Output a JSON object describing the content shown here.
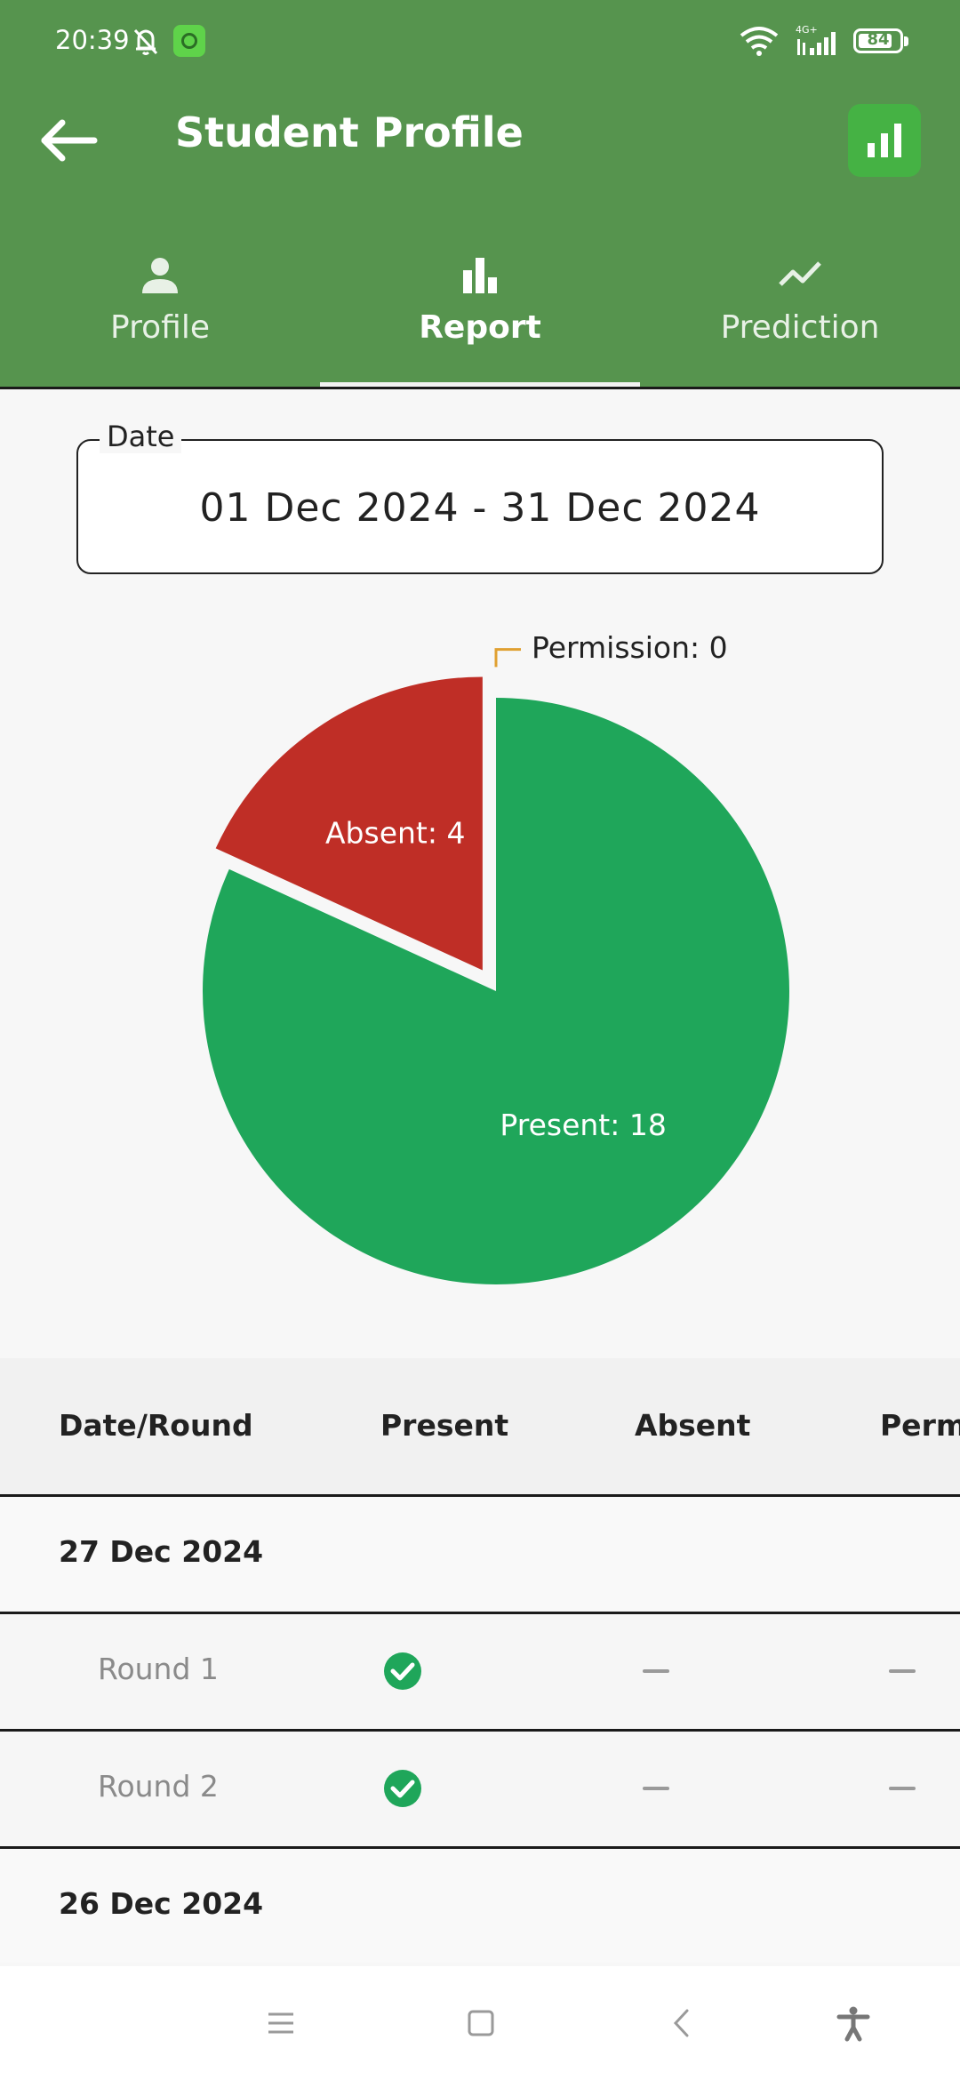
{
  "status_bar": {
    "time": "20:39",
    "battery": "84",
    "battery_level": 0.84,
    "network": "4G+"
  },
  "app_bar": {
    "title": "Student Profile"
  },
  "tabs": [
    {
      "label": "Profile",
      "icon": "person-icon"
    },
    {
      "label": "Report",
      "icon": "bar-chart-icon"
    },
    {
      "label": "Prediction",
      "icon": "trending-icon"
    }
  ],
  "active_tab": 1,
  "date_filter": {
    "label": "Date",
    "value": "01 Dec 2024 - 31 Dec 2024"
  },
  "chart_data": {
    "type": "pie",
    "slices": [
      {
        "label": "Present",
        "value": 18,
        "color": "#1fa65a",
        "text": "Present: 18"
      },
      {
        "label": "Absent",
        "value": 4,
        "color": "#bf2e26",
        "text": "Absent: 4"
      },
      {
        "label": "Permission",
        "value": 0,
        "color": "#e0a030",
        "text": "Permission: 0"
      }
    ]
  },
  "table": {
    "columns": [
      "Date/Round",
      "Present",
      "Absent",
      "Perm"
    ],
    "groups": [
      {
        "date": "27 Dec 2024",
        "rounds": [
          {
            "label": "Round 1",
            "present": true,
            "absent": false,
            "permission": false
          },
          {
            "label": "Round 2",
            "present": true,
            "absent": false,
            "permission": false
          }
        ]
      },
      {
        "date": "26 Dec 2024",
        "rounds": []
      }
    ]
  },
  "colors": {
    "primary": "#56944e",
    "accent": "#45b244",
    "present": "#1fa65a",
    "absent": "#bf2e26",
    "permission": "#e0a030"
  }
}
